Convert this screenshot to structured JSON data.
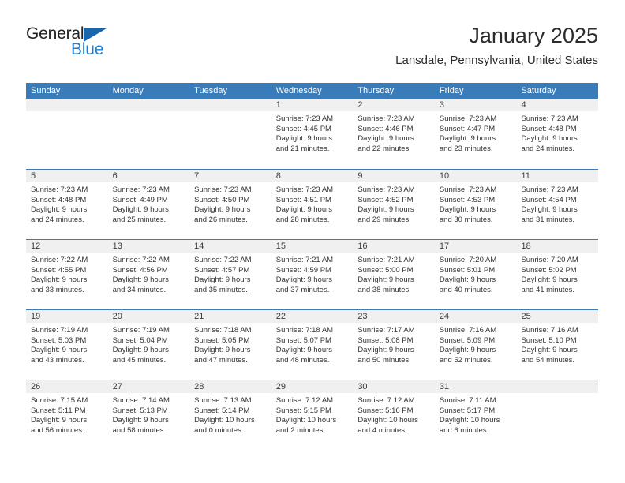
{
  "brand": {
    "name_part1": "General",
    "name_part2": "Blue",
    "triangle_color": "#1866ac",
    "blue_color": "#1e7fd4"
  },
  "header": {
    "title": "January 2025",
    "subtitle": "Lansdale, Pennsylvania, United States",
    "header_bg": "#3a7cba",
    "header_text_color": "#ffffff",
    "daynum_band_bg": "#f0f0f0"
  },
  "weekday_headers": [
    "Sunday",
    "Monday",
    "Tuesday",
    "Wednesday",
    "Thursday",
    "Friday",
    "Saturday"
  ],
  "weeks": [
    [
      {
        "day": "",
        "lines": []
      },
      {
        "day": "",
        "lines": []
      },
      {
        "day": "",
        "lines": []
      },
      {
        "day": "1",
        "lines": [
          "Sunrise: 7:23 AM",
          "Sunset: 4:45 PM",
          "Daylight: 9 hours",
          "and 21 minutes."
        ]
      },
      {
        "day": "2",
        "lines": [
          "Sunrise: 7:23 AM",
          "Sunset: 4:46 PM",
          "Daylight: 9 hours",
          "and 22 minutes."
        ]
      },
      {
        "day": "3",
        "lines": [
          "Sunrise: 7:23 AM",
          "Sunset: 4:47 PM",
          "Daylight: 9 hours",
          "and 23 minutes."
        ]
      },
      {
        "day": "4",
        "lines": [
          "Sunrise: 7:23 AM",
          "Sunset: 4:48 PM",
          "Daylight: 9 hours",
          "and 24 minutes."
        ]
      }
    ],
    [
      {
        "day": "5",
        "lines": [
          "Sunrise: 7:23 AM",
          "Sunset: 4:48 PM",
          "Daylight: 9 hours",
          "and 24 minutes."
        ]
      },
      {
        "day": "6",
        "lines": [
          "Sunrise: 7:23 AM",
          "Sunset: 4:49 PM",
          "Daylight: 9 hours",
          "and 25 minutes."
        ]
      },
      {
        "day": "7",
        "lines": [
          "Sunrise: 7:23 AM",
          "Sunset: 4:50 PM",
          "Daylight: 9 hours",
          "and 26 minutes."
        ]
      },
      {
        "day": "8",
        "lines": [
          "Sunrise: 7:23 AM",
          "Sunset: 4:51 PM",
          "Daylight: 9 hours",
          "and 28 minutes."
        ]
      },
      {
        "day": "9",
        "lines": [
          "Sunrise: 7:23 AM",
          "Sunset: 4:52 PM",
          "Daylight: 9 hours",
          "and 29 minutes."
        ]
      },
      {
        "day": "10",
        "lines": [
          "Sunrise: 7:23 AM",
          "Sunset: 4:53 PM",
          "Daylight: 9 hours",
          "and 30 minutes."
        ]
      },
      {
        "day": "11",
        "lines": [
          "Sunrise: 7:23 AM",
          "Sunset: 4:54 PM",
          "Daylight: 9 hours",
          "and 31 minutes."
        ]
      }
    ],
    [
      {
        "day": "12",
        "lines": [
          "Sunrise: 7:22 AM",
          "Sunset: 4:55 PM",
          "Daylight: 9 hours",
          "and 33 minutes."
        ]
      },
      {
        "day": "13",
        "lines": [
          "Sunrise: 7:22 AM",
          "Sunset: 4:56 PM",
          "Daylight: 9 hours",
          "and 34 minutes."
        ]
      },
      {
        "day": "14",
        "lines": [
          "Sunrise: 7:22 AM",
          "Sunset: 4:57 PM",
          "Daylight: 9 hours",
          "and 35 minutes."
        ]
      },
      {
        "day": "15",
        "lines": [
          "Sunrise: 7:21 AM",
          "Sunset: 4:59 PM",
          "Daylight: 9 hours",
          "and 37 minutes."
        ]
      },
      {
        "day": "16",
        "lines": [
          "Sunrise: 7:21 AM",
          "Sunset: 5:00 PM",
          "Daylight: 9 hours",
          "and 38 minutes."
        ]
      },
      {
        "day": "17",
        "lines": [
          "Sunrise: 7:20 AM",
          "Sunset: 5:01 PM",
          "Daylight: 9 hours",
          "and 40 minutes."
        ]
      },
      {
        "day": "18",
        "lines": [
          "Sunrise: 7:20 AM",
          "Sunset: 5:02 PM",
          "Daylight: 9 hours",
          "and 41 minutes."
        ]
      }
    ],
    [
      {
        "day": "19",
        "lines": [
          "Sunrise: 7:19 AM",
          "Sunset: 5:03 PM",
          "Daylight: 9 hours",
          "and 43 minutes."
        ]
      },
      {
        "day": "20",
        "lines": [
          "Sunrise: 7:19 AM",
          "Sunset: 5:04 PM",
          "Daylight: 9 hours",
          "and 45 minutes."
        ]
      },
      {
        "day": "21",
        "lines": [
          "Sunrise: 7:18 AM",
          "Sunset: 5:05 PM",
          "Daylight: 9 hours",
          "and 47 minutes."
        ]
      },
      {
        "day": "22",
        "lines": [
          "Sunrise: 7:18 AM",
          "Sunset: 5:07 PM",
          "Daylight: 9 hours",
          "and 48 minutes."
        ]
      },
      {
        "day": "23",
        "lines": [
          "Sunrise: 7:17 AM",
          "Sunset: 5:08 PM",
          "Daylight: 9 hours",
          "and 50 minutes."
        ]
      },
      {
        "day": "24",
        "lines": [
          "Sunrise: 7:16 AM",
          "Sunset: 5:09 PM",
          "Daylight: 9 hours",
          "and 52 minutes."
        ]
      },
      {
        "day": "25",
        "lines": [
          "Sunrise: 7:16 AM",
          "Sunset: 5:10 PM",
          "Daylight: 9 hours",
          "and 54 minutes."
        ]
      }
    ],
    [
      {
        "day": "26",
        "lines": [
          "Sunrise: 7:15 AM",
          "Sunset: 5:11 PM",
          "Daylight: 9 hours",
          "and 56 minutes."
        ]
      },
      {
        "day": "27",
        "lines": [
          "Sunrise: 7:14 AM",
          "Sunset: 5:13 PM",
          "Daylight: 9 hours",
          "and 58 minutes."
        ]
      },
      {
        "day": "28",
        "lines": [
          "Sunrise: 7:13 AM",
          "Sunset: 5:14 PM",
          "Daylight: 10 hours",
          "and 0 minutes."
        ]
      },
      {
        "day": "29",
        "lines": [
          "Sunrise: 7:12 AM",
          "Sunset: 5:15 PM",
          "Daylight: 10 hours",
          "and 2 minutes."
        ]
      },
      {
        "day": "30",
        "lines": [
          "Sunrise: 7:12 AM",
          "Sunset: 5:16 PM",
          "Daylight: 10 hours",
          "and 4 minutes."
        ]
      },
      {
        "day": "31",
        "lines": [
          "Sunrise: 7:11 AM",
          "Sunset: 5:17 PM",
          "Daylight: 10 hours",
          "and 6 minutes."
        ]
      },
      {
        "day": "",
        "lines": []
      }
    ]
  ]
}
